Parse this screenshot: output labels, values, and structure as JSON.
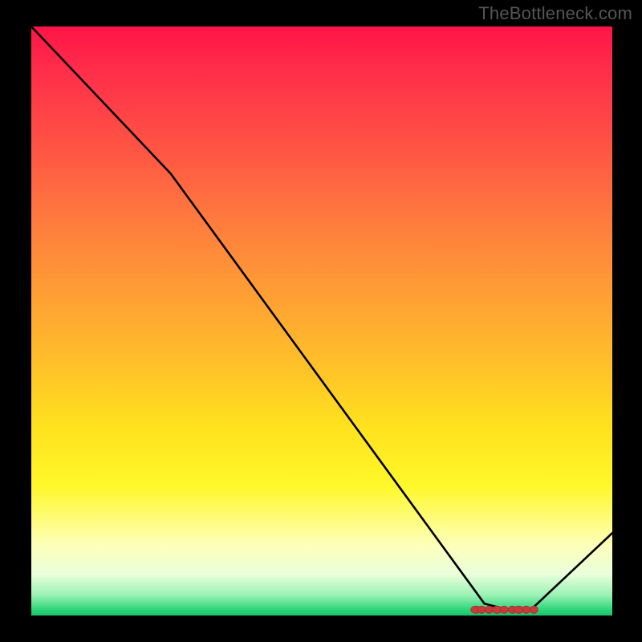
{
  "watermark": "TheBottleneck.com",
  "chart_data": {
    "type": "line",
    "title": "",
    "xlabel": "",
    "ylabel": "",
    "xlim": [
      0,
      100
    ],
    "ylim": [
      0,
      100
    ],
    "grid": false,
    "series": [
      {
        "name": "curve",
        "x": [
          0,
          24,
          78,
          82,
          86,
          100
        ],
        "values": [
          100,
          75,
          2,
          1,
          1,
          14
        ]
      }
    ],
    "markers": {
      "name": "optimal-cluster",
      "x": [
        76.5,
        77.5,
        78.8,
        80.2,
        81.4,
        82.8,
        83.9,
        85.2,
        86.5
      ],
      "values": [
        1.0,
        1.0,
        1.0,
        1.0,
        1.0,
        1.0,
        1.0,
        1.0,
        1.0
      ],
      "shape": "overlapping-circles"
    },
    "gradient_stops": [
      {
        "pos": 0.0,
        "color": "#ff1447"
      },
      {
        "pos": 0.08,
        "color": "#ff2f4a"
      },
      {
        "pos": 0.22,
        "color": "#ff5843"
      },
      {
        "pos": 0.34,
        "color": "#ff7e3d"
      },
      {
        "pos": 0.46,
        "color": "#ffa034"
      },
      {
        "pos": 0.58,
        "color": "#ffc228"
      },
      {
        "pos": 0.68,
        "color": "#ffe21e"
      },
      {
        "pos": 0.78,
        "color": "#fff82a"
      },
      {
        "pos": 0.88,
        "color": "#fdffb9"
      },
      {
        "pos": 0.93,
        "color": "#e9ffdb"
      },
      {
        "pos": 0.965,
        "color": "#9cf2b6"
      },
      {
        "pos": 0.99,
        "color": "#2cd67a"
      },
      {
        "pos": 1.0,
        "color": "#1fbf6e"
      }
    ]
  }
}
